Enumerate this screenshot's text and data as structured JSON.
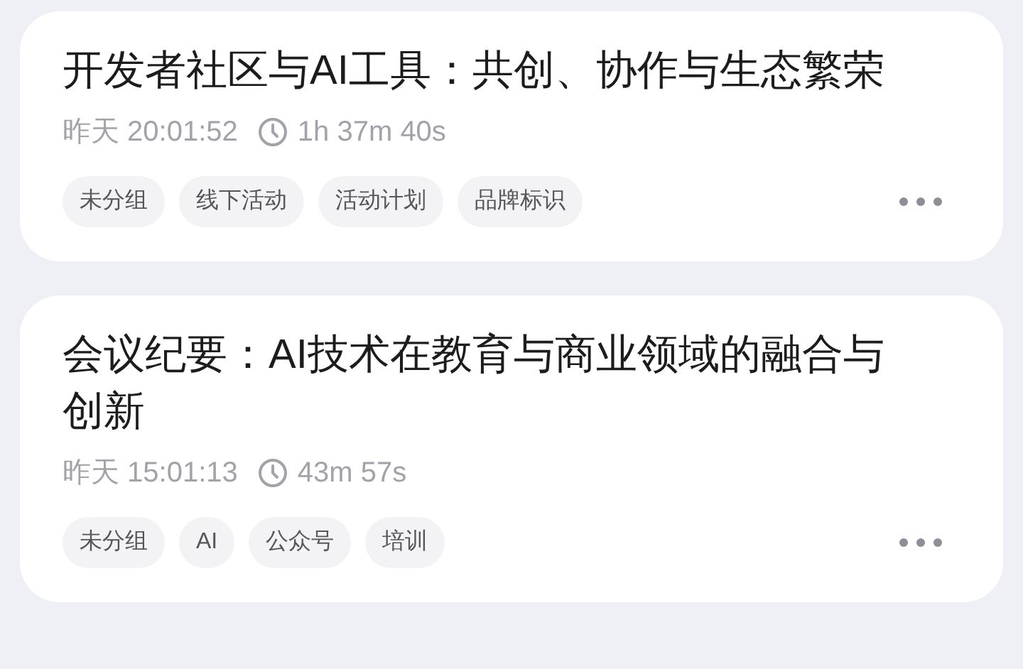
{
  "notes": [
    {
      "title": "开发者社区与AI工具：共创、协作与生态繁荣",
      "time": "昨天 20:01:52",
      "duration": "1h 37m 40s",
      "tags": [
        "未分组",
        "线下活动",
        "活动计划",
        "品牌标识"
      ]
    },
    {
      "title": "会议纪要：AI技术在教育与商业领域的融合与创新",
      "time": "昨天 15:01:13",
      "duration": "43m 57s",
      "tags": [
        "未分组",
        "AI",
        "公众号",
        "培训"
      ]
    }
  ]
}
